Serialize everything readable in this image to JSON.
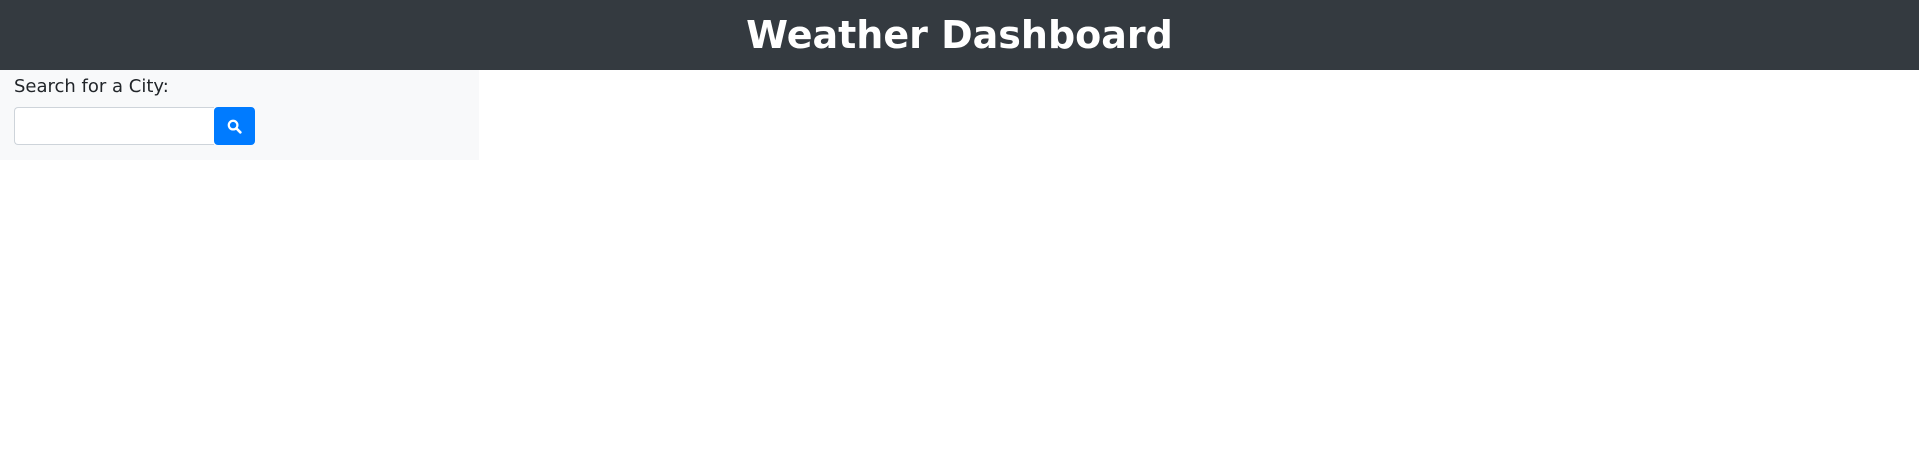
{
  "header": {
    "title": "Weather Dashboard"
  },
  "search": {
    "label": "Search for a City:",
    "value": "",
    "placeholder": "",
    "button_icon": "search-icon"
  },
  "colors": {
    "header_bg": "#343a40",
    "panel_bg": "#f8f9fa",
    "button_bg": "#007bff"
  }
}
